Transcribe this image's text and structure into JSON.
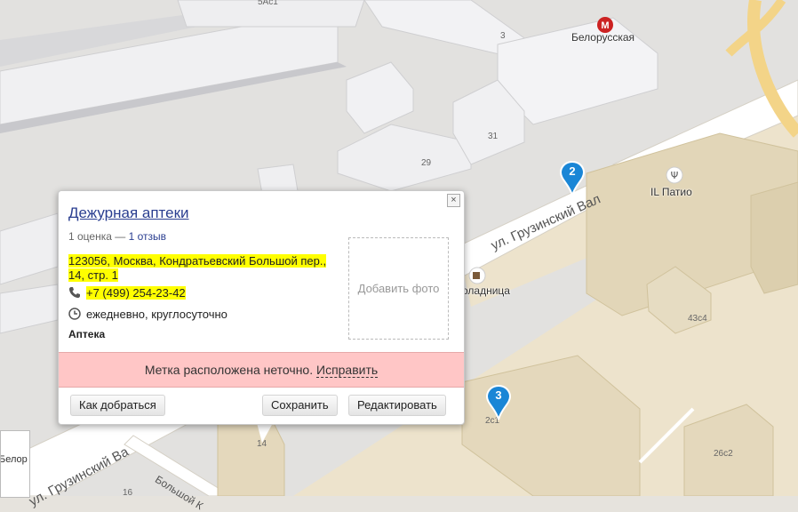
{
  "map": {
    "building_numbers": [
      "5Ас1",
      "3",
      "31",
      "29",
      "43с4",
      "2с1",
      "26с2",
      "14",
      "16"
    ],
    "metro": {
      "name": "Белорусская",
      "color": "#cc2222"
    },
    "pois": [
      {
        "name": "IL Патио",
        "icon": "fork-knife-icon"
      },
      {
        "name": "оладница",
        "icon": "coffee-cup-icon"
      }
    ],
    "streets": [
      {
        "name": "ул. Грузинский Вал"
      },
      {
        "name": "ул. Грузинский Вал",
        "fragment": "ул. Грузинский Ва"
      },
      {
        "name": "Большой К"
      }
    ],
    "partial_label": "Белор",
    "markers": [
      {
        "number": "2",
        "color": "#1a86d6"
      },
      {
        "number": "3",
        "color": "#1a86d6"
      }
    ]
  },
  "popup": {
    "title": "Дежурная аптеки",
    "rating_count": "1 оценка",
    "separator": "—",
    "reviews_link": "1 отзыв",
    "address": "123056, Москва, Кондратьевский Большой пер., 14, стр. 1",
    "phone": "+7 (499) 254-23-42",
    "hours": "ежедневно, круглосуточно",
    "category": "Аптека",
    "add_photo": "Добавить фото",
    "warning_text": "Метка расположена неточно.",
    "warning_link": "Исправить",
    "buttons": {
      "route": "Как добраться",
      "save": "Сохранить",
      "edit": "Редактировать"
    },
    "close_symbol": "×"
  },
  "colors": {
    "highlight": "#ffff00",
    "warning_bg": "#ffc6c6",
    "link": "#2a3e90",
    "road": "#f6dd9a"
  }
}
